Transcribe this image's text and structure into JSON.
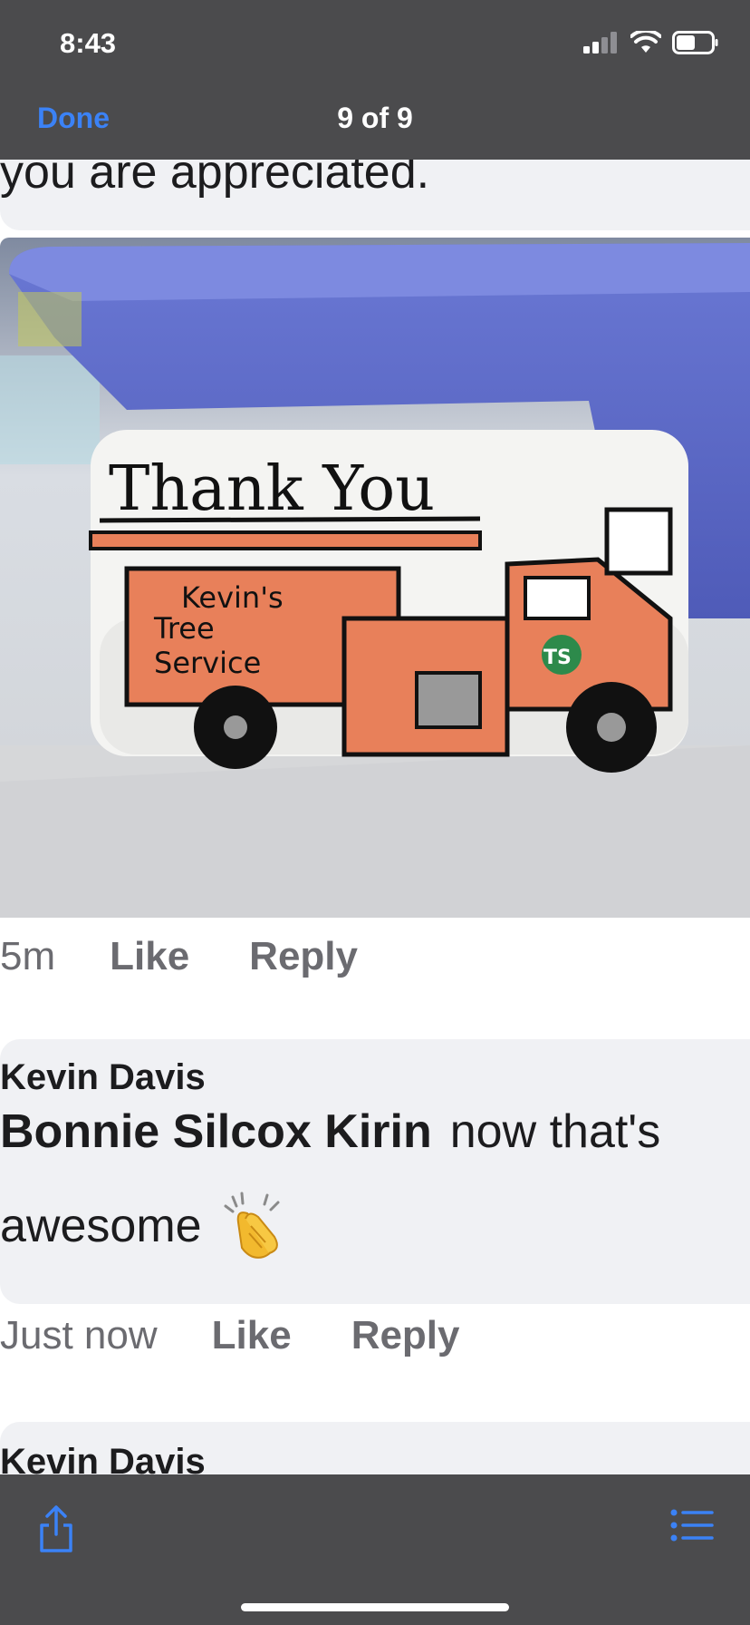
{
  "status": {
    "time": "8:43"
  },
  "nav": {
    "done_label": "Done",
    "title": "9 of 9"
  },
  "post": {
    "caption_tail": "you are appreciated.",
    "photo_text": {
      "headline": "Thank You",
      "line1": "Kevin's",
      "line2": "Tree",
      "line3": "Service",
      "logo": "TS"
    },
    "meta": {
      "time": "5m",
      "like": "Like",
      "reply": "Reply"
    }
  },
  "comment": {
    "author": "Kevin Davis",
    "mention": "Bonnie Silcox Kirin",
    "text_start": "now that's",
    "text_end": "awesome",
    "emoji": "clapping-hands",
    "meta": {
      "time": "Just now",
      "like": "Like",
      "reply": "Reply"
    }
  },
  "next_comment": {
    "author": "Kevin Davis"
  },
  "colors": {
    "accent": "#3b82f6",
    "bar": "#4b4b4d",
    "bubble": "#f0f1f4",
    "truck": "#e8805a"
  }
}
